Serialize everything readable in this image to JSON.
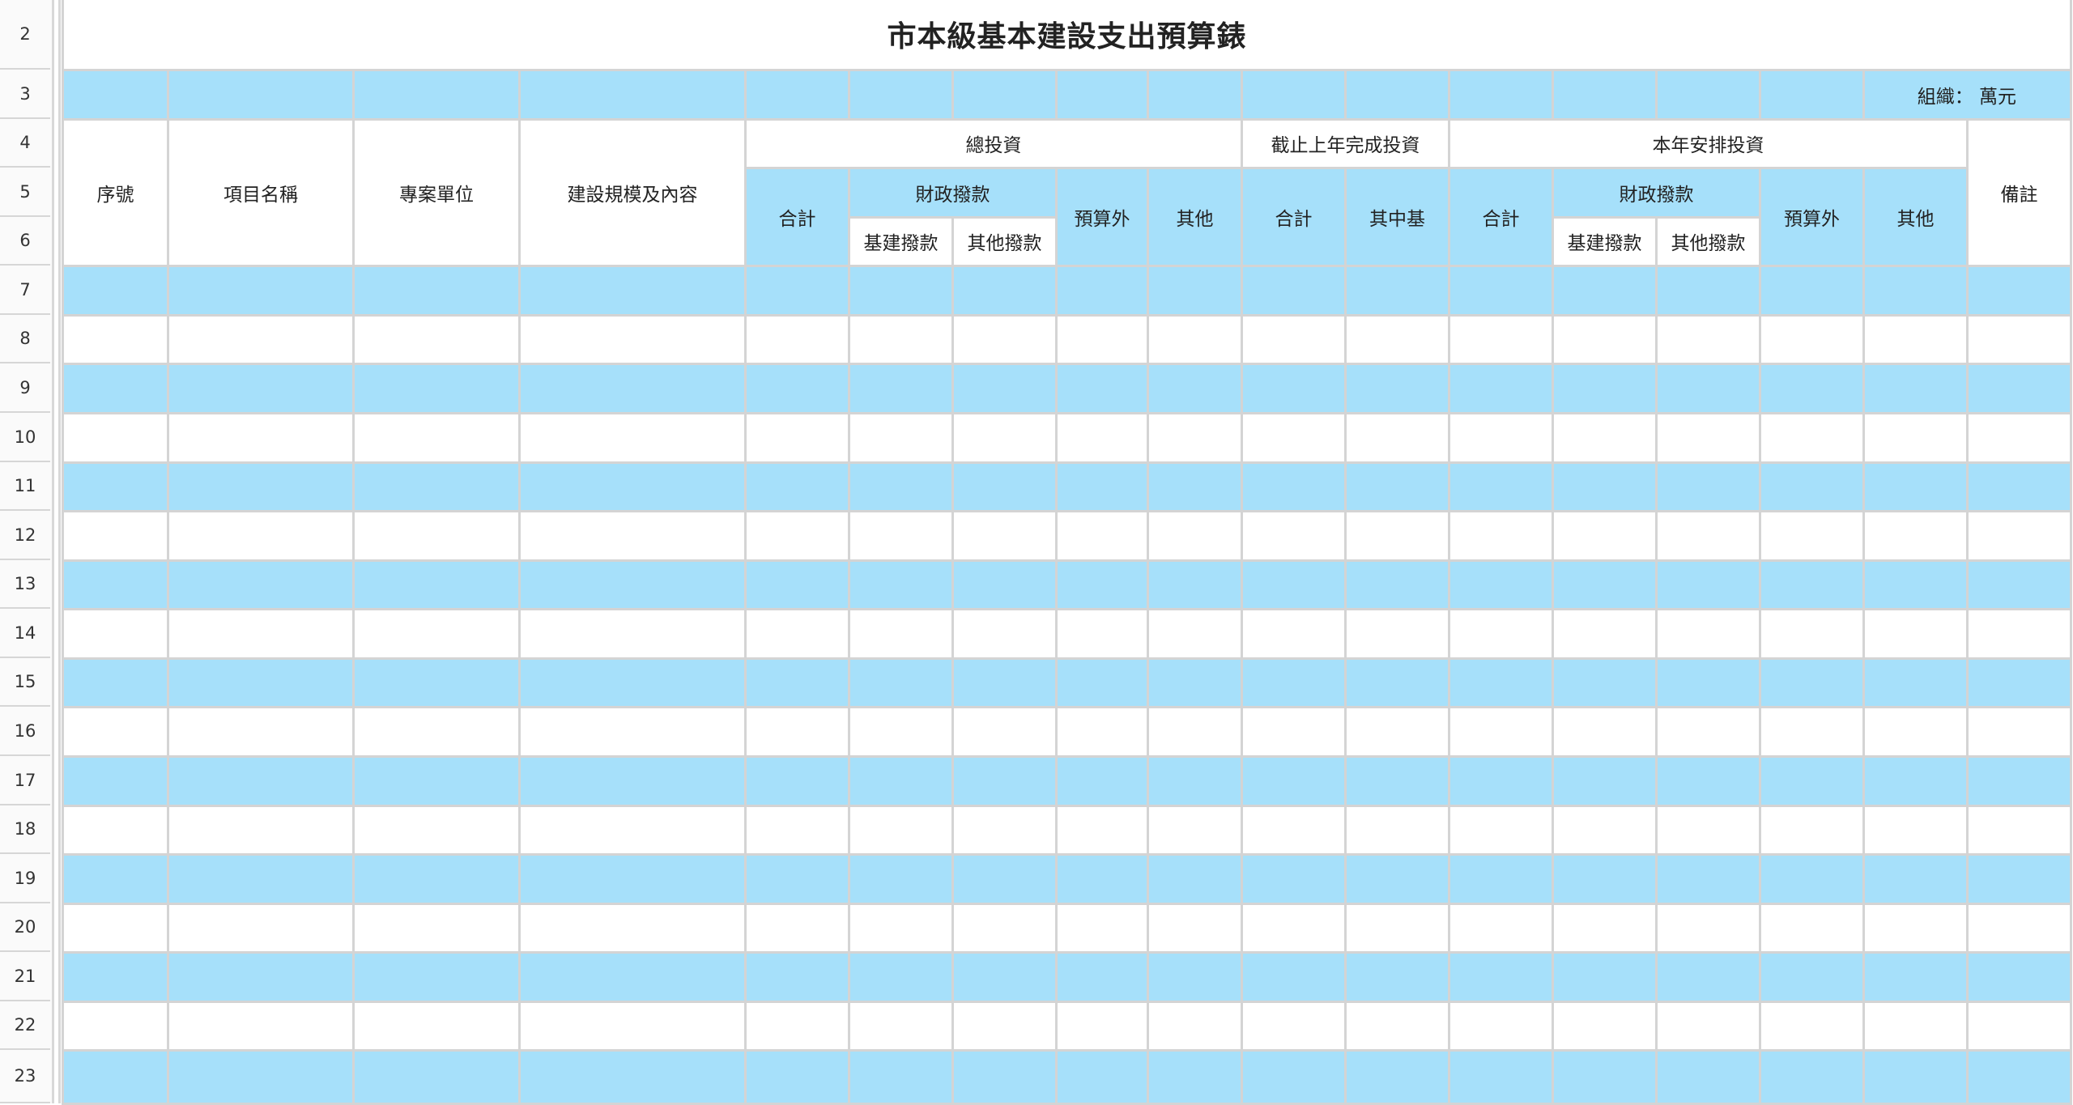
{
  "row_numbers": [
    "2",
    "3",
    "4",
    "5",
    "6",
    "7",
    "8",
    "9",
    "10",
    "11",
    "12",
    "13",
    "14",
    "15",
    "16",
    "17",
    "18",
    "19",
    "20",
    "21",
    "22",
    "23"
  ],
  "title": "市本級基本建設支出預算錶",
  "unit_label": "組織：  萬元",
  "headers": {
    "serial": "序號",
    "project_name": "項目名稱",
    "project_unit": "專案單位",
    "scale_content": "建設規模及內容",
    "total_investment": "總投資",
    "completed_by_last_year": "截止上年完成投資",
    "this_year_investment": "本年安排投資",
    "remarks": "備註",
    "ti_total": "合計",
    "ti_fiscal": "財政撥款",
    "ti_extra_budget": "預算外",
    "ti_other": "其他",
    "ti_basic_construction": "基建撥款",
    "ti_other_allocation": "其他撥款",
    "cl_total": "合計",
    "cl_of_which": "其中基",
    "ty_total": "合計",
    "ty_fiscal": "財政撥款",
    "ty_extra_budget": "預算外",
    "ty_other": "其他",
    "ty_basic_construction": "基建撥款",
    "ty_other_allocation": "其他撥款"
  },
  "colors": {
    "band_blue": "#a6e0fa",
    "grid_line": "#d4d4d4",
    "white": "#ffffff"
  }
}
